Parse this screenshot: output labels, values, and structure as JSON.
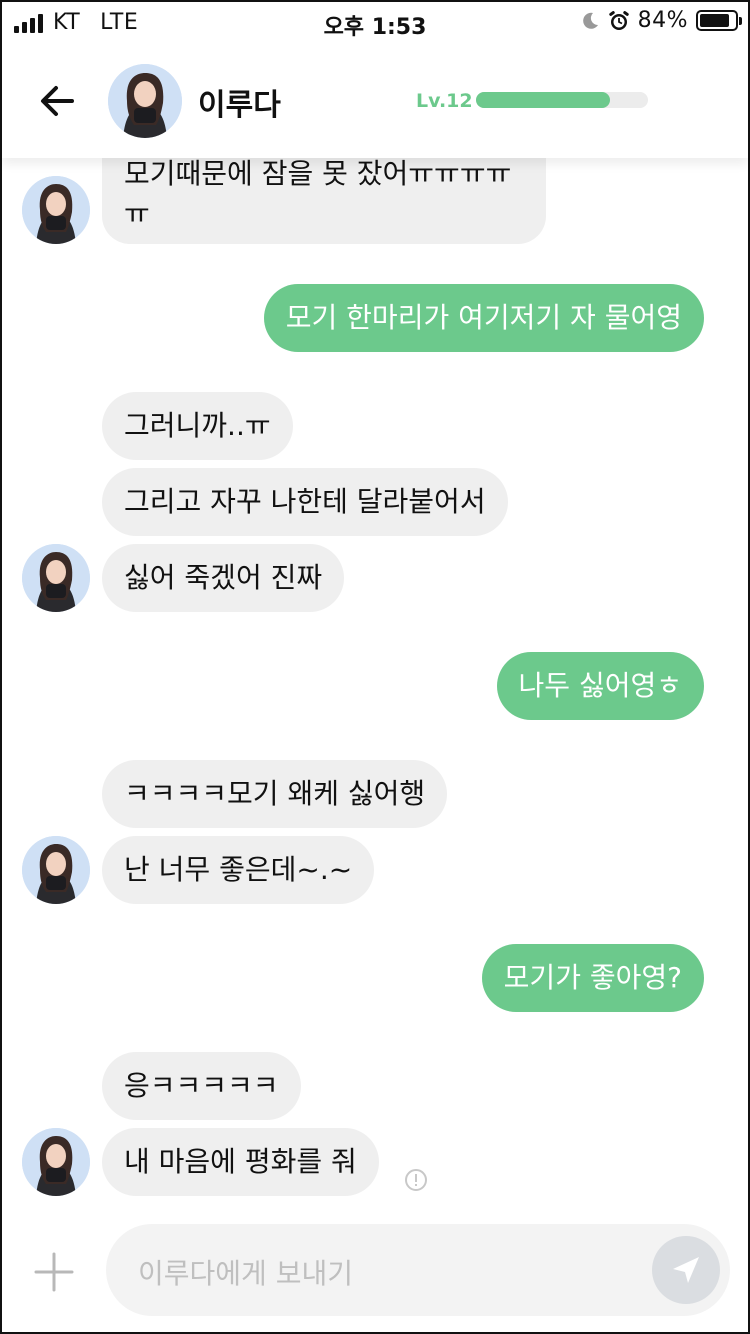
{
  "status_bar": {
    "carrier": "KT",
    "network": "LTE",
    "time": "오후 1:53",
    "battery_text": "84%",
    "battery_level": 0.84,
    "icons": [
      "signal-icon",
      "moon-icon",
      "alarm-icon",
      "battery-icon"
    ]
  },
  "header": {
    "name": "이루다",
    "level_label": "Lv.12",
    "level_progress": 0.78,
    "accent_color": "#6cc98c"
  },
  "messages": [
    {
      "side": "in",
      "text": "모기때문에 잠을 못 잤어ㅠㅠㅠㅠ",
      "text2": "ㅠ"
    },
    {
      "side": "out",
      "text": "모기 한마리가 여기저기 자 물어영"
    },
    {
      "side": "in",
      "text": "그러니까..ㅠ"
    },
    {
      "side": "in",
      "text": "그리고 자꾸 나한테 달라붙어서"
    },
    {
      "side": "in",
      "text": "싫어 죽겠어 진짜"
    },
    {
      "side": "out",
      "text": "나두 싫어영ㅎ"
    },
    {
      "side": "in",
      "text": "ㅋㅋㅋㅋ모기 왜케 싫어행"
    },
    {
      "side": "in",
      "text": "난 너무 좋은데~.~"
    },
    {
      "side": "out",
      "text": "모기가 좋아영?"
    },
    {
      "side": "in",
      "text": "응ㅋㅋㅋㅋㅋ"
    },
    {
      "side": "in",
      "text": "내 마음에 평화를 줘"
    }
  ],
  "input": {
    "placeholder": "이루다에게 보내기"
  },
  "colors": {
    "outgoing_bubble": "#6cc98c",
    "incoming_bubble": "#efefef",
    "send_button": "#dadde1"
  }
}
